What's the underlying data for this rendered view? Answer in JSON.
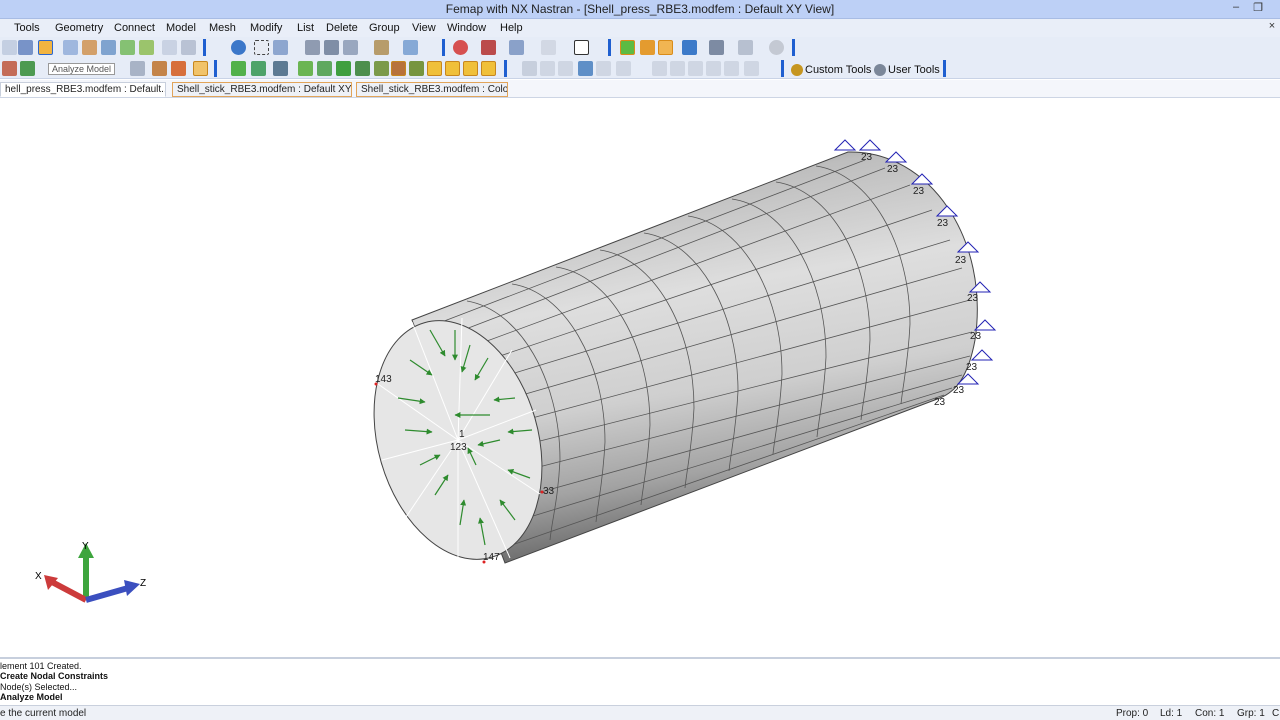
{
  "window": {
    "title": "Femap with NX Nastran - [Shell_press_RBE3.modfem : Default XY View]",
    "minimize": "–",
    "restore": "❐",
    "close_inner": "×"
  },
  "menu": [
    "Tools",
    "Geometry",
    "Connect",
    "Model",
    "Mesh",
    "Modify",
    "List",
    "Delete",
    "Group",
    "View",
    "Window",
    "Help"
  ],
  "toolbar": {
    "tooltip": "Analyze Model",
    "custom_tools": "Custom Tools",
    "user_tools": "User Tools"
  },
  "tabs": [
    {
      "label": "hell_press_RBE3.modfem : Default..."
    },
    {
      "label": "Shell_stick_RBE3.modfem : Default XY..."
    },
    {
      "label": "Shell_stick_RBE3.modfem : Color"
    }
  ],
  "model": {
    "labels": {
      "n143": "143",
      "n123": "123",
      "n1": "1",
      "n33": "33",
      "n147": "147",
      "c23": "23"
    },
    "colors": {
      "shell_light": "#e3e3e3",
      "shell_dark": "#5a5a5a",
      "load_arrow": "#2e8b2e",
      "constraint": "#2323b4"
    }
  },
  "axes": {
    "x": "X",
    "y": "Y",
    "z": "Z"
  },
  "messages": [
    {
      "text": "lement 101 Created.",
      "bold": false
    },
    {
      "text": "Create Nodal Constraints",
      "bold": true
    },
    {
      "text": "Node(s) Selected...",
      "bold": false
    },
    {
      "text": "Analyze Model",
      "bold": true
    }
  ],
  "status": {
    "hint": "e the current model",
    "prop": "Prop: 0",
    "ld": "Ld: 1",
    "con": "Con: 1",
    "grp": "Grp: 1",
    "trail": "C"
  }
}
